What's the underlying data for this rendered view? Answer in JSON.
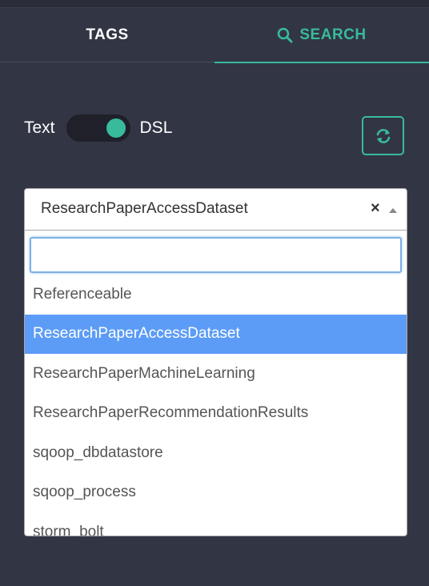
{
  "tabs": {
    "tags_label": "TAGS",
    "search_label": "SEARCH"
  },
  "mode": {
    "text_label": "Text",
    "dsl_label": "DSL"
  },
  "select": {
    "selected_value": "ResearchPaperAccessDataset",
    "clear_symbol": "×",
    "search_placeholder": "",
    "options": [
      {
        "label": "Referenceable",
        "selected": false
      },
      {
        "label": "ResearchPaperAccessDataset",
        "selected": true
      },
      {
        "label": "ResearchPaperMachineLearning",
        "selected": false
      },
      {
        "label": "ResearchPaperRecommendationResults",
        "selected": false
      },
      {
        "label": "sqoop_dbdatastore",
        "selected": false
      },
      {
        "label": "sqoop_process",
        "selected": false
      },
      {
        "label": "storm_bolt",
        "selected": false
      }
    ]
  },
  "icons": {
    "search": "search-icon",
    "refresh": "refresh-icon"
  },
  "colors": {
    "background": "#323544",
    "accent": "#38bb9b",
    "highlight": "#5c9cf6"
  }
}
